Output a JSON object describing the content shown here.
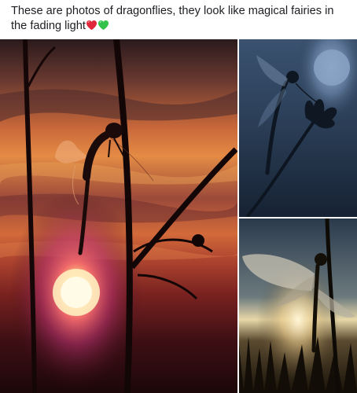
{
  "post": {
    "caption": "These are photos of dragonflies, they look like magical fairies in the fading light",
    "emojis": [
      "red-heart-icon",
      "green-heart-icon"
    ]
  },
  "photos": [
    {
      "name": "sunset-dragonfly-photo"
    },
    {
      "name": "moonlit-dragonfly-photo"
    },
    {
      "name": "dewy-dragonfly-photo"
    }
  ],
  "colors": {
    "sunset_orange": "#e06a2a",
    "sun_core": "#fff3c4",
    "night_blue": "#2c3f56",
    "dew_gold": "#c9a25a",
    "heart_red": "#e0283a",
    "heart_green": "#33c24a"
  }
}
